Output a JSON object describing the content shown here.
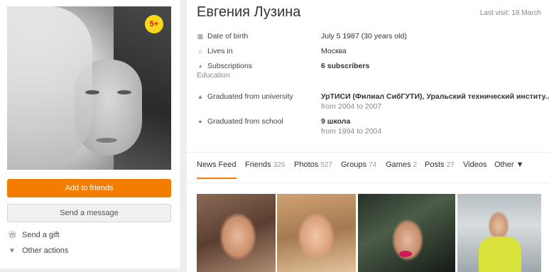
{
  "profile": {
    "name": "Евгения Лузина",
    "last_visit": "Last visit: 18 March",
    "age_badge": "5+"
  },
  "actions": {
    "add_friends": "Add to friends",
    "send_message": "Send a message",
    "send_gift": "Send a gift",
    "other_actions": "Other actions"
  },
  "info": {
    "dob_label": "Date of birth",
    "dob_value": "July 5 1987 (30 years old)",
    "lives_label": "Lives in",
    "lives_value": "Москва",
    "subs_label": "Subscriptions",
    "subs_value": "6 subscribers",
    "education_label": "Education",
    "univ_label": "Graduated from university",
    "univ_value": "УрТИСИ (Филиал СибГУТИ), Уральский технический институ...",
    "univ_years": "from 2004 to 2007",
    "school_label": "Graduated from school",
    "school_value": "9 школа",
    "school_years": "from 1994 to 2004"
  },
  "tabs": [
    {
      "label": "News Feed",
      "count": ""
    },
    {
      "label": "Friends",
      "count": "326"
    },
    {
      "label": "Photos",
      "count": "527"
    },
    {
      "label": "Groups",
      "count": "74"
    },
    {
      "label": "Games",
      "count": "2"
    },
    {
      "label": "Posts",
      "count": "27"
    },
    {
      "label": "Videos",
      "count": ""
    },
    {
      "label": "Other ▼",
      "count": ""
    }
  ],
  "colors": {
    "accent": "#f27d00",
    "badge": "#f9d71c",
    "badge_text": "#e0181b"
  },
  "icons": [
    "calendar-icon",
    "house-icon",
    "rss-icon",
    "graduation-cap-icon",
    "pin-icon",
    "gift-icon",
    "triangle-down-icon"
  ]
}
